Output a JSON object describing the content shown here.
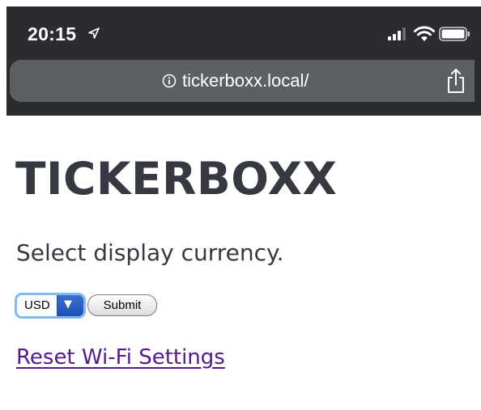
{
  "status_bar": {
    "time": "20:15",
    "icons": [
      "location-arrow-icon",
      "signal-icon",
      "wifi-icon",
      "battery-icon"
    ]
  },
  "browser": {
    "url": "tickerboxx.local/",
    "info_icon": "info-circle-icon",
    "share_icon": "share-icon"
  },
  "page": {
    "title": "TICKERBOXX",
    "prompt": "Select display currency.",
    "currency_select": {
      "selected": "USD"
    },
    "submit_label": "Submit",
    "reset_link": "Reset Wi-Fi Settings"
  },
  "colors": {
    "chrome_bg": "#2b2c30",
    "url_bar_bg": "#5d6063",
    "title_text": "#363942",
    "link_visited": "#551a8b",
    "select_focus": "#7fbaf5",
    "select_arrow": "#2f5fc4"
  }
}
